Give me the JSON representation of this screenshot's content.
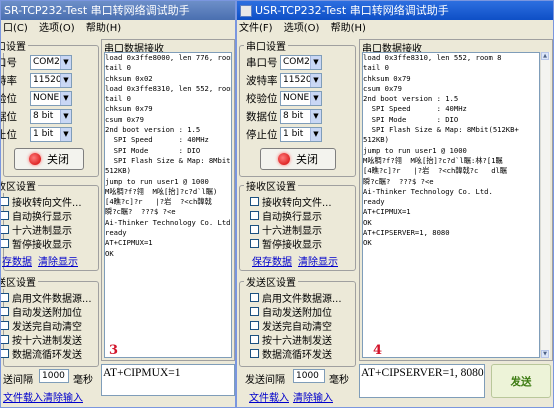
{
  "left": {
    "title": "SR-TCP232-Test 串口转网络调试助手",
    "menu": [
      "口(C)",
      "选项(O)",
      "帮助(H)"
    ],
    "port_group": "口设置",
    "port_label": "口号",
    "baud_label": "特率",
    "parity_label": "验位",
    "databits_label": "据位",
    "stopbits_label": "止位",
    "port": "COM2",
    "baud": "115200",
    "parity": "NONE",
    "databits": "8 bit",
    "stopbits": "1 bit",
    "close_label": "关闭",
    "recv_group": "收区设置",
    "recv_opts": [
      "接收转向文件...",
      "自动换行显示",
      "十六进制显示",
      "暂停接收显示"
    ],
    "save_data": "存数据",
    "clear_display": "清除显示",
    "send_group": "送区设置",
    "send_opts": [
      "启用文件数据源...",
      "自动发送附加位",
      "发送完自动清空",
      "按十六进制发送",
      "数据流循环发送"
    ],
    "interval_label": "送间隔",
    "interval_value": "1000",
    "ms_label": "毫秒",
    "file_load": "文件载入",
    "clear_input": "清除输入",
    "recv_title": "串口数据接收",
    "recv_lines": [
      "load 0x3ffe8000, len 776, room",
      "tail 0",
      "chksum 0x02",
      "load 0x3ffe8310, len 552, room",
      "tail 0",
      "chksum 0x79",
      "csum 0x79",
      "",
      "2nd boot version : 1.5",
      "  SPI Speed      : 40MHz",
      "  SPI Mode       : DIO",
      "  SPI Flash Size & Map: 8Mbit",
      "512KB)",
      "jump to run user1 @ 1000",
      "",
      "M吆稠?f?翎  M吆[抬]?c?d`l瞩)",
      "[4瞧?c]?r   |?岩  ?<ch韓戟",
      "瞬?c瞩?  ???$ ?<e",
      "Ai-Thinker Technology Co. Ltd",
      "",
      "ready",
      "AT+CIPMUX=1",
      "",
      "OK"
    ],
    "annotation": "3",
    "send_text": "AT+CIPMUX=1"
  },
  "right": {
    "title": "USR-TCP232-Test 串口转网络调试助手",
    "menu": [
      "文件(F)",
      "选项(O)",
      "帮助(H)"
    ],
    "port_group": "串口设置",
    "port_label": "串口号",
    "baud_label": "波特率",
    "parity_label": "校验位",
    "databits_label": "数据位",
    "stopbits_label": "停止位",
    "port": "COM2",
    "baud": "115200",
    "parity": "NONE",
    "databits": "8 bit",
    "stopbits": "1 bit",
    "close_label": "关闭",
    "recv_group": "接收区设置",
    "recv_opts": [
      "接收转向文件...",
      "自动换行显示",
      "十六进制显示",
      "暂停接收显示"
    ],
    "save_data": "保存数据",
    "clear_display": "清除显示",
    "send_group": "发送区设置",
    "send_opts": [
      "启用文件数据源...",
      "自动发送附加位",
      "发送完自动清空",
      "按十六进制发送",
      "数据流循环发送"
    ],
    "interval_label": "发送间隔",
    "interval_value": "1000",
    "ms_label": "毫秒",
    "file_load": "文件载入",
    "clear_input": "清除输入",
    "recv_title": "串口数据接收",
    "recv_lines": [
      "load 0x3ffe8310, len 552, room 8",
      "tail 0",
      "chksum 0x79",
      "csum 0x79",
      "",
      "2nd boot version : 1.5",
      "  SPI Speed      : 40MHz",
      "  SPI Mode       : DIO",
      "  SPI Flash Size & Map: 8Mbit(512KB+",
      "512KB)",
      "jump to run user1 @ 1000",
      "",
      "M吆稠?f?翎  M吆[抬]?c?d`l瞩:林?[1瞩",
      "[4瞧?c]?r   |?岩  ?<ch韓戟?c   dl瞩",
      "瞬?c瞩?  ???$ ?<e",
      "Ai-Thinker Technology Co. Ltd.",
      "",
      "ready",
      "AT+CIPMUX=1",
      "",
      "OK",
      "AT+CIPSERVER=1, 8080",
      "",
      "OK"
    ],
    "annotation": "4",
    "send_text": "AT+CIPSERVER=1, 8080",
    "send_button": "发送"
  }
}
